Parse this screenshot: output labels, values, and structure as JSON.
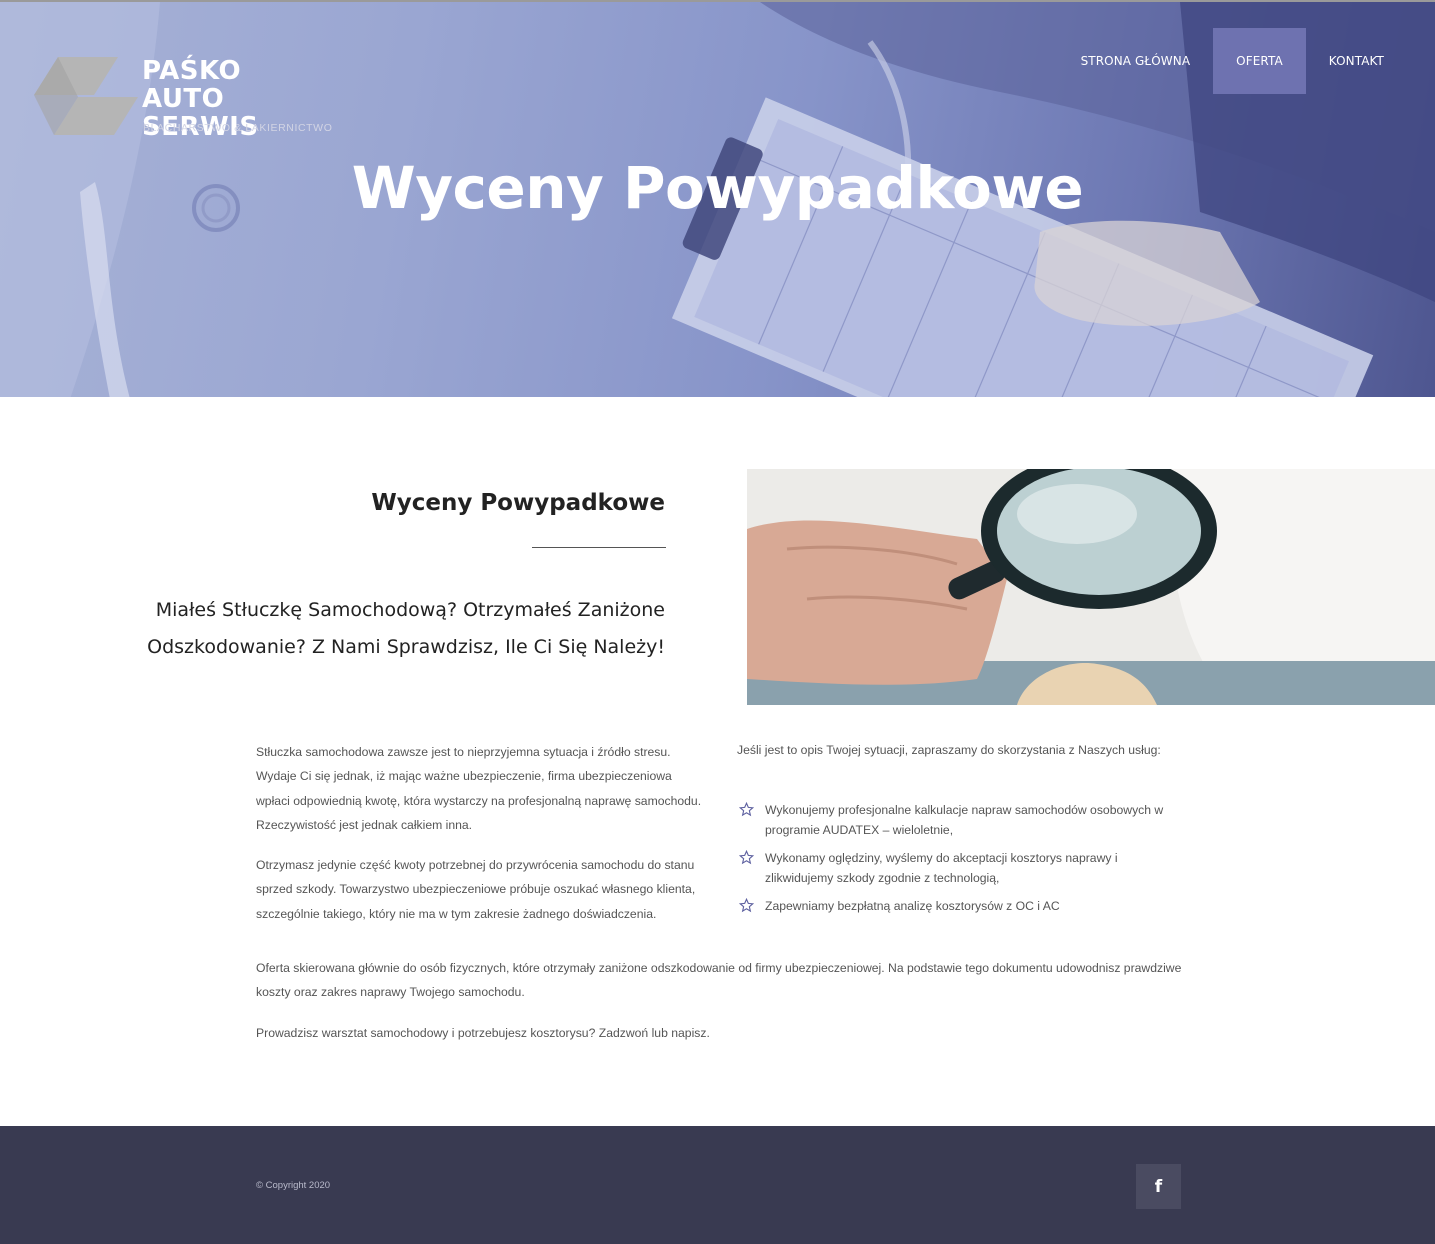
{
  "brand": {
    "line1": "PAŚKO",
    "line2": "AUTO SERWIS",
    "tagline": "BLACHARSTWO & LAKIERNICTWO"
  },
  "nav": {
    "items": [
      {
        "label": "STRONA GŁÓWNA",
        "active": false
      },
      {
        "label": "OFERTA",
        "active": true
      },
      {
        "label": "KONTAKT",
        "active": false
      }
    ]
  },
  "hero": {
    "title": "Wyceny Powypadkowe"
  },
  "section": {
    "title": "Wyceny Powypadkowe",
    "lead": "Miałeś Stłuczkę Samochodową? Otrzymałeś Zaniżone Odszkodowanie? Z Nami Sprawdzisz, Ile Ci Się Należy!"
  },
  "content": {
    "left_paragraphs": [
      "Stłuczka samochodowa zawsze jest to nieprzyjemna sytuacja i źródło stresu. Wydaje Ci się jednak, iż mając ważne ubezpieczenie, firma ubezpieczeniowa wpłaci odpowiednią kwotę, która wystarczy na profesjonalną naprawę samochodu. Rzeczywistość jest jednak całkiem inna.",
      "Otrzymasz jedynie część kwoty potrzebnej do przywrócenia samochodu do stanu sprzed szkody. Towarzystwo ubezpieczeniowe próbuje oszukać własnego klienta, szczególnie takiego, który nie ma w tym zakresie żadnego doświadczenia."
    ],
    "right_intro": "Jeśli jest to opis Twojej sytuacji, zapraszamy do skorzystania z Naszych usług:",
    "bullets": [
      "Wykonujemy profesjonalne kalkulacje napraw samochodów osobowych w programie AUDATEX – wieloletnie,",
      "Wykonamy oględziny, wyślemy do akceptacji kosztorys naprawy i zlikwidujemy szkody zgodnie z technologią,",
      "Zapewniamy bezpłatną analizę kosztorysów z OC i AC"
    ],
    "full_paragraphs": [
      "Oferta skierowana głównie do osób fizycznych, które otrzymały zaniżone odszkodowanie od firmy ubezpieczeniowej. Na podstawie tego dokumentu udowodnisz prawdziwe koszty oraz zakres naprawy Twojego samochodu.",
      "Prowadzisz warsztat samochodowy i potrzebujesz kosztorysu? Zadzwoń lub napisz."
    ]
  },
  "footer": {
    "copyright": "© Copyright  2020",
    "facebook_icon": "f"
  },
  "colors": {
    "accent": "#6e72b0",
    "footer_bg": "#393a51",
    "text_body": "#555555"
  }
}
